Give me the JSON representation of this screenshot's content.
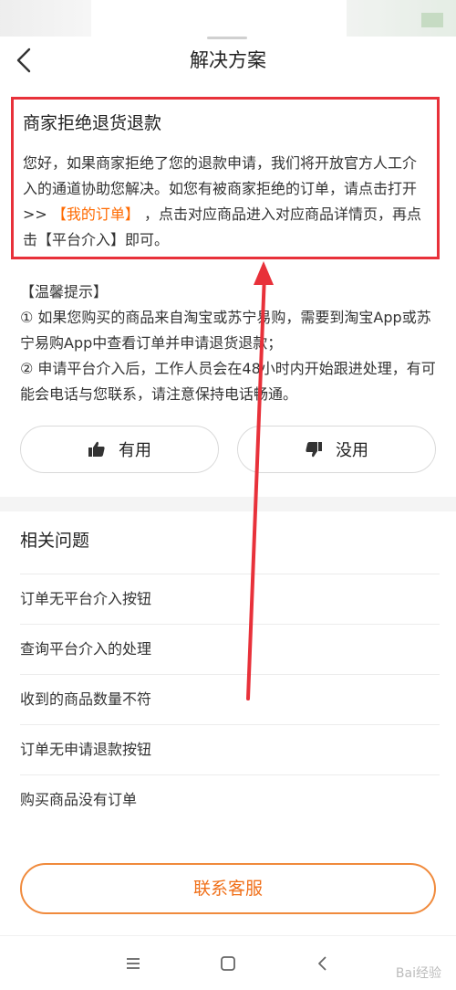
{
  "header": {
    "title": "解决方案"
  },
  "solution": {
    "title": "商家拒绝退货退款",
    "body_part1": "您好，如果商家拒绝了您的退款申请，我们将开放官方人工介入的通道协助您解决。如您有被商家拒绝的订单，请点击打开>> ",
    "link_text": "【我的订单】",
    "body_part2": " ，点击对应商品进入对应商品详情页，再点击【平台介入】即可。"
  },
  "tips": {
    "heading": "【温馨提示】",
    "item1": "① 如果您购买的商品来自淘宝或苏宁易购，需要到淘宝App或苏宁易购App中查看订单并申请退货退款；",
    "item2": "② 申请平台介入后，工作人员会在48小时内开始跟进处理，有可能会电话与您联系，请注意保持电话畅通。"
  },
  "feedback": {
    "useful_label": "有用",
    "useless_label": "没用"
  },
  "related": {
    "title": "相关问题",
    "items": [
      "订单无平台介入按钮",
      "查询平台介入的处理",
      "收到的商品数量不符",
      "订单无申请退款按钮",
      "购买商品没有订单"
    ]
  },
  "contact": {
    "label": "联系客服"
  },
  "colors": {
    "accent": "#ff6a00",
    "annotation": "#e8313a"
  }
}
